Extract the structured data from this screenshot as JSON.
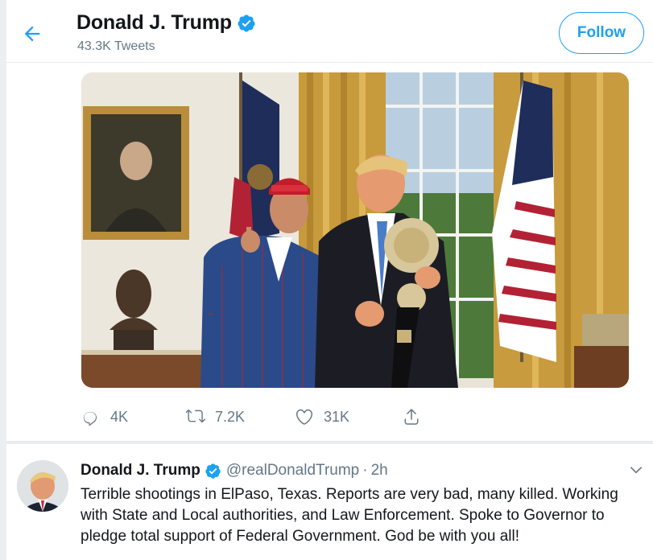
{
  "header": {
    "name": "Donald J. Trump",
    "tweet_count": "43.3K Tweets",
    "follow_label": "Follow"
  },
  "tweet": {
    "replies": "4K",
    "retweets": "7.2K",
    "likes": "31K"
  },
  "next_tweet": {
    "name": "Donald J. Trump",
    "handle": "@realDonaldTrump",
    "separator": "·",
    "time": "2h",
    "text": "Terrible shootings in ElPaso, Texas. Reports are very bad, many killed. Working with State and Local authorities, and Law Enforcement. Spoke to Governor to pledge total support of Federal Government. God be with you all!"
  },
  "colors": {
    "accent": "#1da1f2",
    "muted": "#657786",
    "text": "#14171a",
    "background": "#e6ecf0"
  },
  "icons": [
    "back-arrow-icon",
    "verified-badge-icon",
    "reply-icon",
    "retweet-icon",
    "like-icon",
    "share-icon",
    "chevron-down-icon"
  ]
}
